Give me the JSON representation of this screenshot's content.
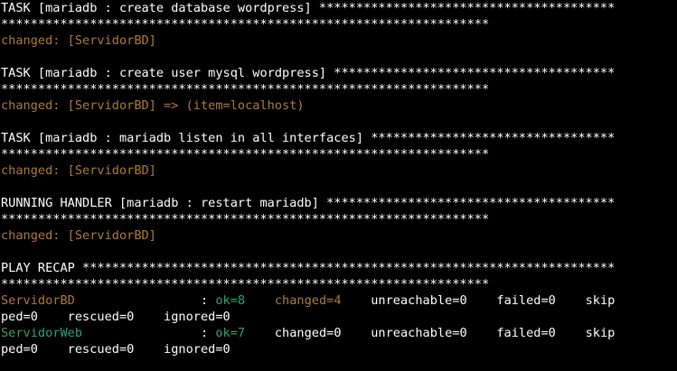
{
  "colors": {
    "background": "#000000",
    "text": "#ffffff",
    "changed": "#b07a3a",
    "ok": "#2fa37a"
  },
  "lines": [
    {
      "type": "task-header",
      "segments": [
        {
          "text": "TASK [mariadb : create database wordpress] ****************************************",
          "color": "default"
        }
      ]
    },
    {
      "type": "stars",
      "segments": [
        {
          "text": "******************************************************************",
          "color": "default"
        }
      ]
    },
    {
      "type": "result",
      "segments": [
        {
          "text": "changed: [ServidorBD]",
          "color": "changed"
        }
      ]
    },
    {
      "type": "blank",
      "segments": []
    },
    {
      "type": "task-header",
      "segments": [
        {
          "text": "TASK [mariadb : create user mysql wordpress] **************************************",
          "color": "default"
        }
      ]
    },
    {
      "type": "stars",
      "segments": [
        {
          "text": "******************************************************************",
          "color": "default"
        }
      ]
    },
    {
      "type": "result",
      "segments": [
        {
          "text": "changed: [ServidorBD] => (item=localhost)",
          "color": "changed"
        }
      ]
    },
    {
      "type": "blank",
      "segments": []
    },
    {
      "type": "task-header",
      "segments": [
        {
          "text": "TASK [mariadb : mariadb listen in all interfaces] *********************************",
          "color": "default"
        }
      ]
    },
    {
      "type": "stars",
      "segments": [
        {
          "text": "******************************************************************",
          "color": "default"
        }
      ]
    },
    {
      "type": "result",
      "segments": [
        {
          "text": "changed: [ServidorBD]",
          "color": "changed"
        }
      ]
    },
    {
      "type": "blank",
      "segments": []
    },
    {
      "type": "task-header",
      "segments": [
        {
          "text": "RUNNING HANDLER [mariadb : restart mariadb] ***************************************",
          "color": "default"
        }
      ]
    },
    {
      "type": "stars",
      "segments": [
        {
          "text": "******************************************************************",
          "color": "default"
        }
      ]
    },
    {
      "type": "result",
      "segments": [
        {
          "text": "changed: [ServidorBD]",
          "color": "changed"
        }
      ]
    },
    {
      "type": "blank",
      "segments": []
    },
    {
      "type": "recap-header",
      "segments": [
        {
          "text": "PLAY RECAP ************************************************************************",
          "color": "default"
        }
      ]
    },
    {
      "type": "stars",
      "segments": [
        {
          "text": "******************************************************************",
          "color": "default"
        }
      ]
    },
    {
      "type": "recap-row",
      "segments": [
        {
          "text": "ServidorBD",
          "color": "changed"
        },
        {
          "text": "                 : ",
          "color": "default"
        },
        {
          "text": "ok=8",
          "color": "ok"
        },
        {
          "text": "    ",
          "color": "default"
        },
        {
          "text": "changed=4",
          "color": "changed"
        },
        {
          "text": "    unreachable=0    failed=0    skip",
          "color": "default"
        }
      ]
    },
    {
      "type": "recap-wrap",
      "segments": [
        {
          "text": "ped=0    rescued=0    ignored=0",
          "color": "default"
        }
      ]
    },
    {
      "type": "recap-row",
      "segments": [
        {
          "text": "ServidorWeb",
          "color": "ok"
        },
        {
          "text": "                : ",
          "color": "default"
        },
        {
          "text": "ok=7",
          "color": "ok"
        },
        {
          "text": "    changed=0    unreachable=0    failed=0    skip",
          "color": "default"
        }
      ]
    },
    {
      "type": "recap-wrap",
      "segments": [
        {
          "text": "ped=0    rescued=0    ignored=0",
          "color": "default"
        }
      ]
    }
  ]
}
